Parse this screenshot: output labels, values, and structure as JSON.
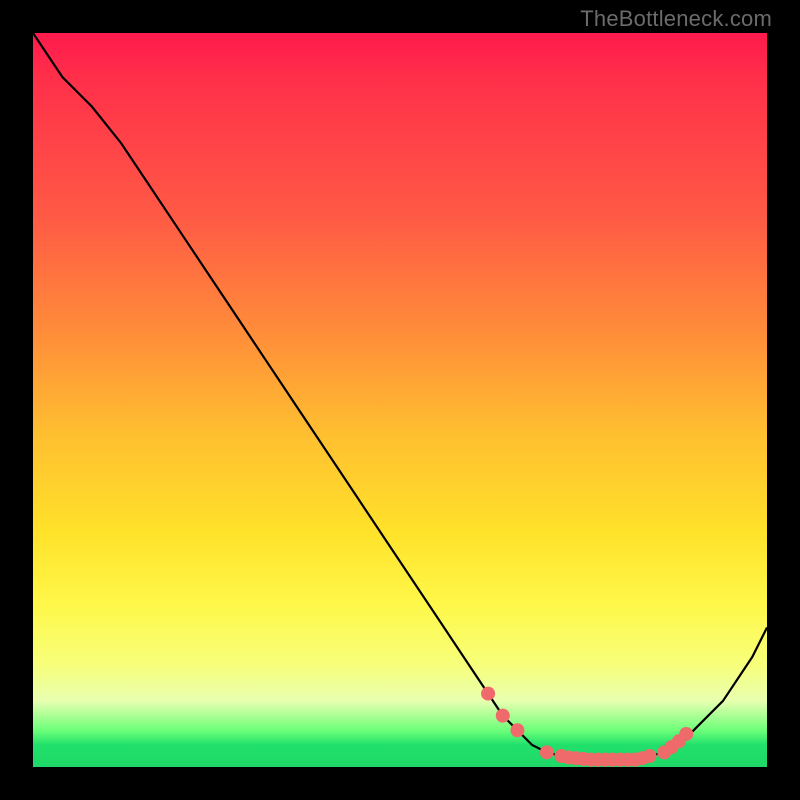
{
  "attribution": "TheBottleneck.com",
  "chart_data": {
    "type": "line",
    "title": "",
    "xlabel": "",
    "ylabel": "",
    "xlim": [
      0,
      100
    ],
    "ylim": [
      0,
      100
    ],
    "series": [
      {
        "name": "bottleneck-curve",
        "x": [
          0,
          4,
          8,
          12,
          16,
          20,
          24,
          28,
          32,
          36,
          40,
          44,
          48,
          52,
          56,
          60,
          62,
          64,
          66,
          68,
          70,
          74,
          78,
          82,
          86,
          88,
          90,
          94,
          98,
          100
        ],
        "y": [
          100,
          94,
          90,
          85,
          79,
          73,
          67,
          61,
          55,
          49,
          43,
          37,
          31,
          25,
          19,
          13,
          10,
          7,
          5,
          3,
          2,
          1,
          1,
          1,
          2,
          3,
          5,
          9,
          15,
          19
        ]
      }
    ],
    "markers": {
      "name": "selected-points",
      "color": "#ef6a6a",
      "radius_px": 7,
      "x": [
        62,
        64,
        66,
        70,
        72,
        73,
        74,
        75,
        76,
        77,
        78,
        79,
        80,
        81,
        82,
        83,
        84,
        86,
        87,
        88,
        89
      ],
      "y": [
        10,
        7,
        5,
        2,
        1.5,
        1.3,
        1.2,
        1.1,
        1.0,
        1.0,
        1.0,
        1.0,
        1.0,
        1.0,
        1.0,
        1.2,
        1.5,
        2,
        2.7,
        3.5,
        4.5
      ]
    }
  }
}
